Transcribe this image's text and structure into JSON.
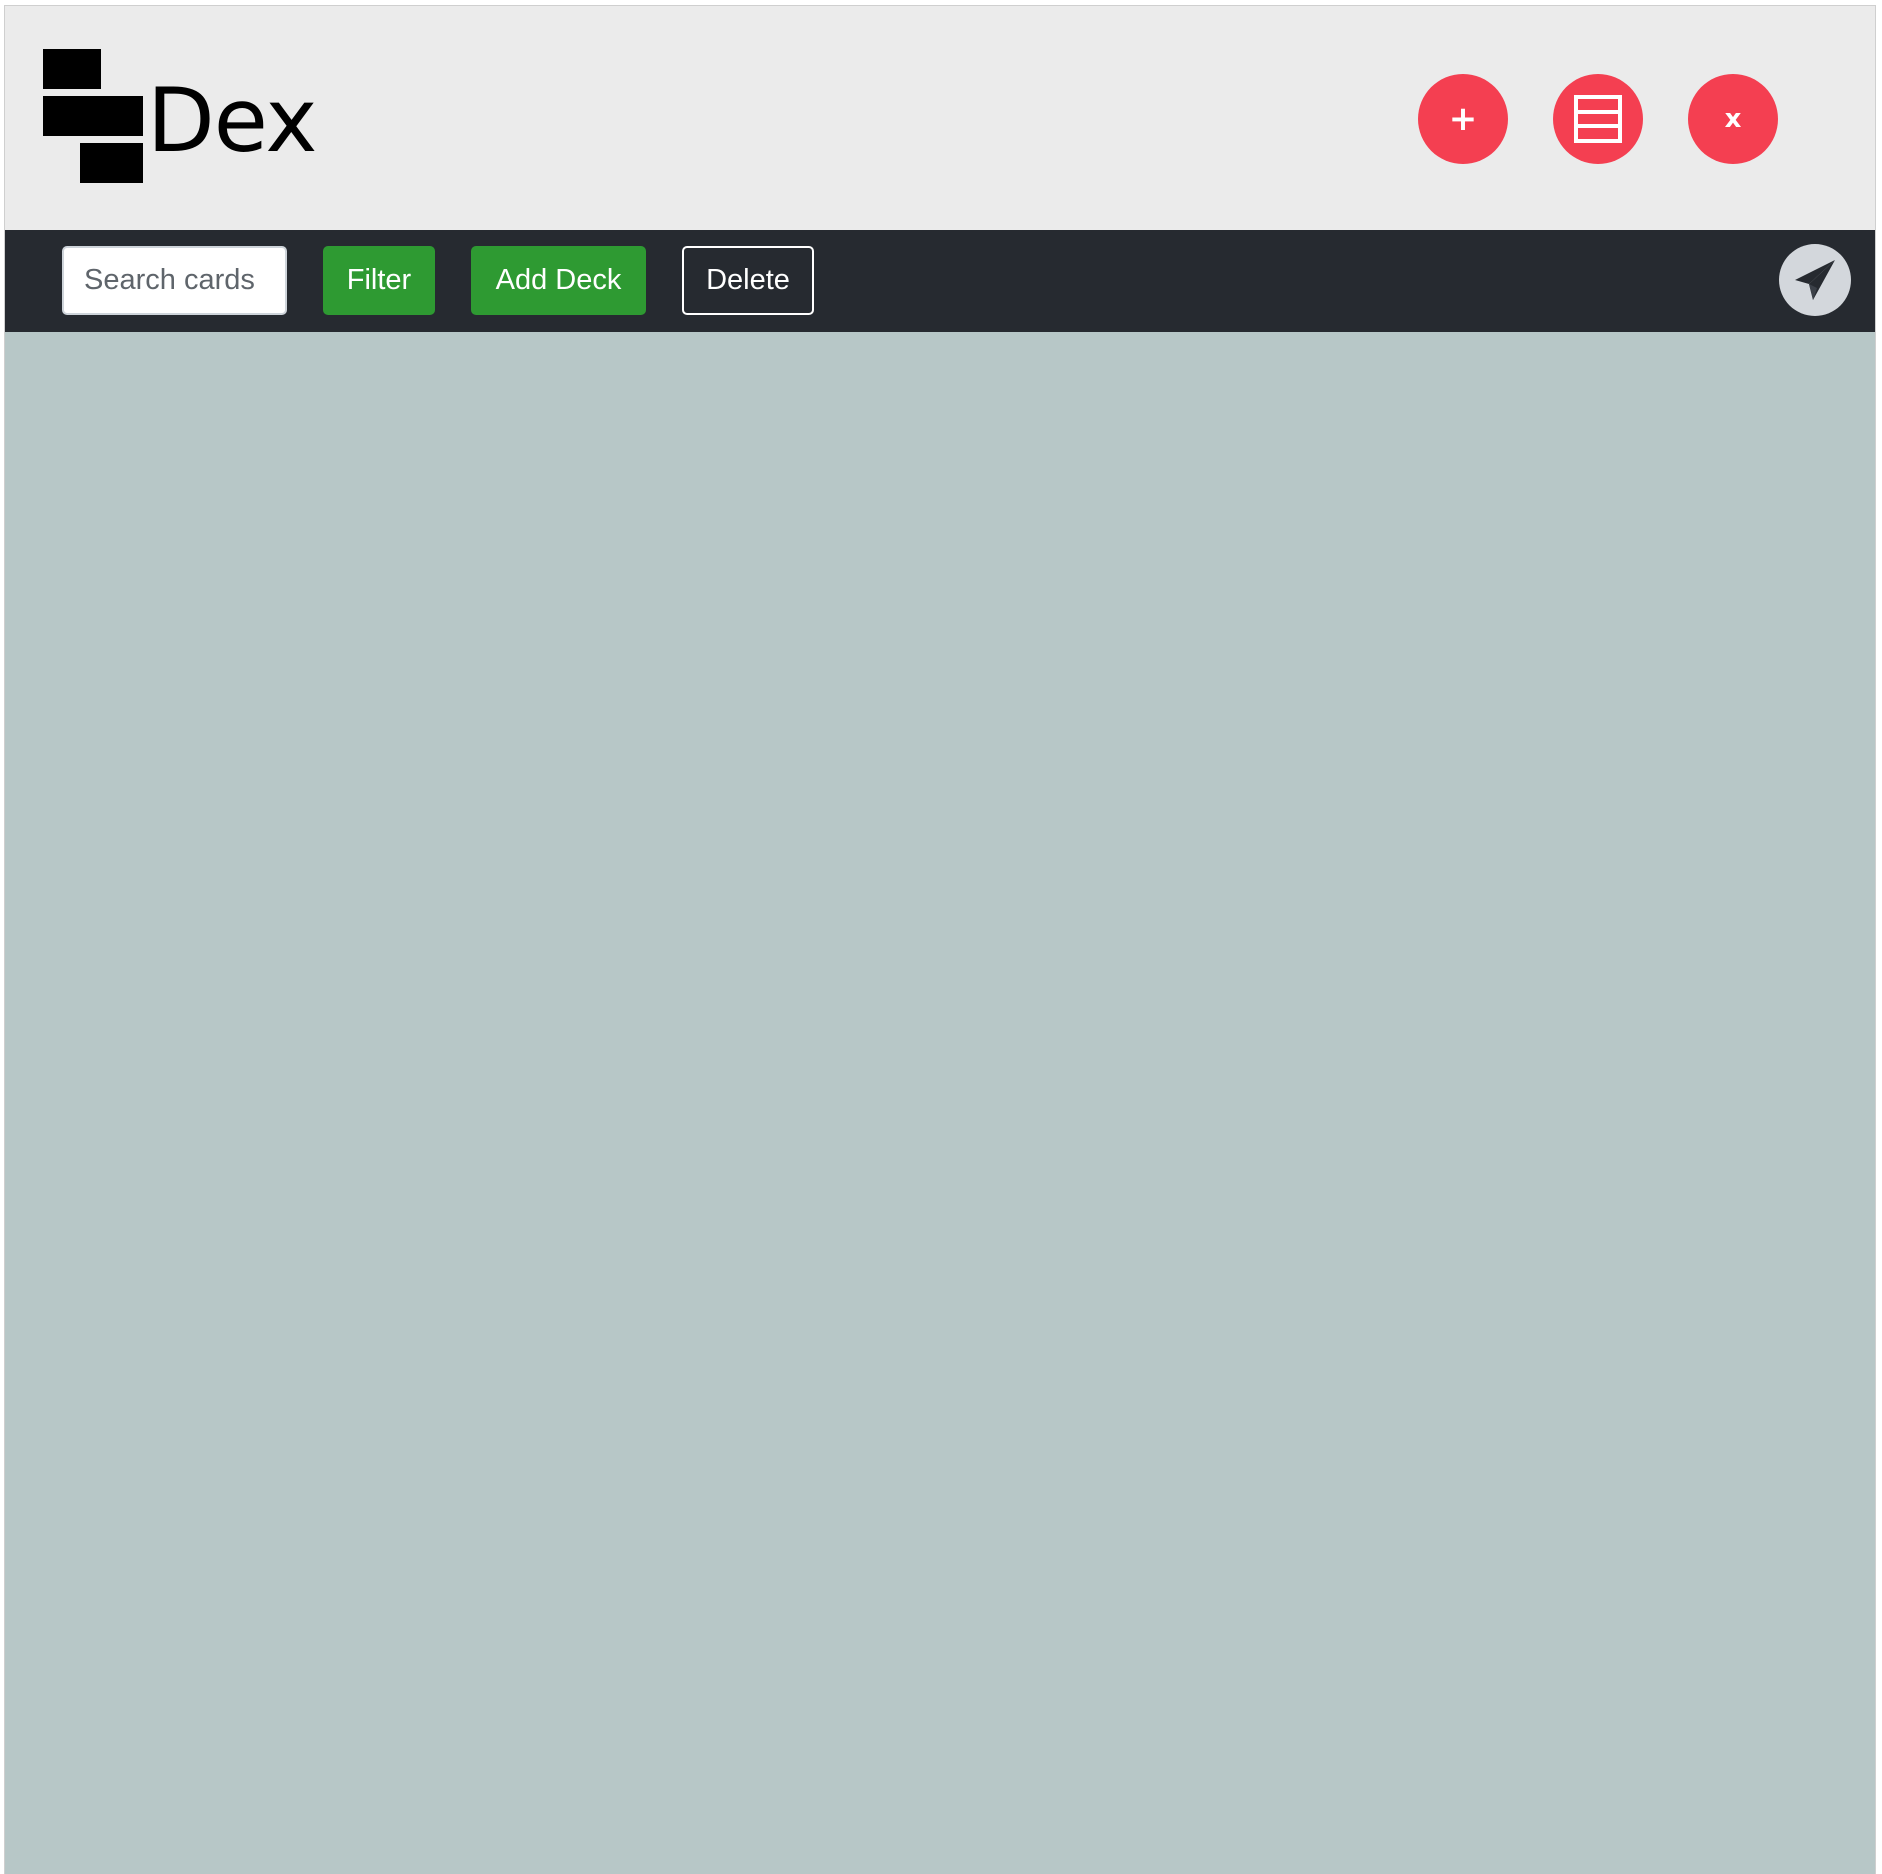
{
  "app": {
    "logo_text": "Dex"
  },
  "header": {
    "add_label": "+",
    "close_label": "x",
    "accent_color": "#f43f51"
  },
  "toolbar": {
    "search_placeholder": "Search cards",
    "search_value": "",
    "filter_label": "Filter",
    "add_deck_label": "Add Deck",
    "delete_label": "Delete",
    "primary_color": "#2e9a32",
    "background_color": "#262a30"
  },
  "icons": {
    "add": "plus-icon",
    "menu": "list-icon",
    "close": "close-icon",
    "send": "paper-plane-icon"
  },
  "content": {
    "background_color": "#b7c7c7"
  }
}
